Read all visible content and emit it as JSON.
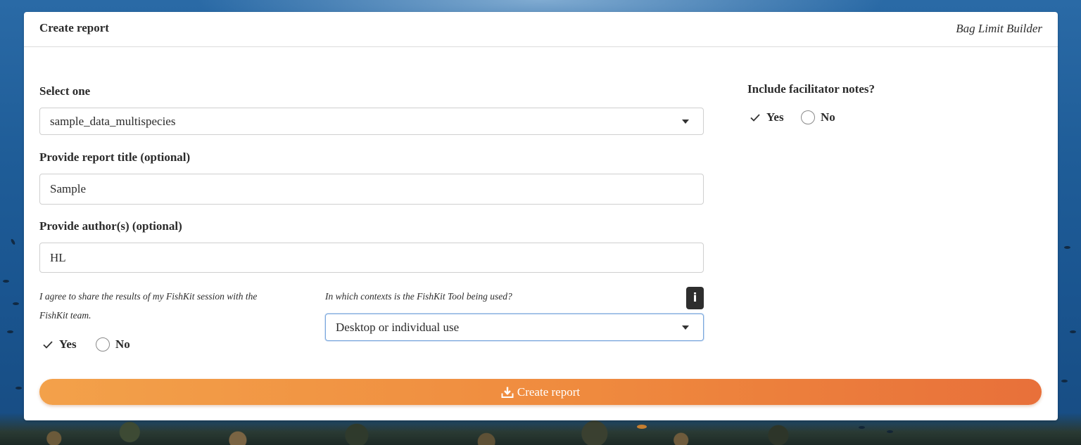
{
  "header": {
    "title": "Create report",
    "brand": "Bag Limit Builder"
  },
  "form": {
    "dataset": {
      "label": "Select one",
      "value": "sample_data_multispecies"
    },
    "title_field": {
      "label": "Provide report title (optional)",
      "value": "Sample"
    },
    "author_field": {
      "label": "Provide author(s) (optional)",
      "value": "HL"
    },
    "share": {
      "label_line1": "I agree to share the results of my FishKit session with the",
      "label_line2": "FishKit team.",
      "yes_label": "Yes",
      "no_label": "No",
      "selected": "Yes"
    },
    "context": {
      "label": "In which contexts is the FishKit Tool being used?",
      "value": "Desktop or individual use",
      "info_glyph": "i"
    },
    "facilitator": {
      "label": "Include facilitator notes?",
      "yes_label": "Yes",
      "no_label": "No",
      "selected": "Yes"
    }
  },
  "actions": {
    "create_label": "Create report",
    "create_icon": "download-icon"
  },
  "colors": {
    "button_start": "#f3a14a",
    "button_end": "#e8703a",
    "focus_border": "#7aa7dd",
    "info_bg": "#2e2e2e"
  }
}
